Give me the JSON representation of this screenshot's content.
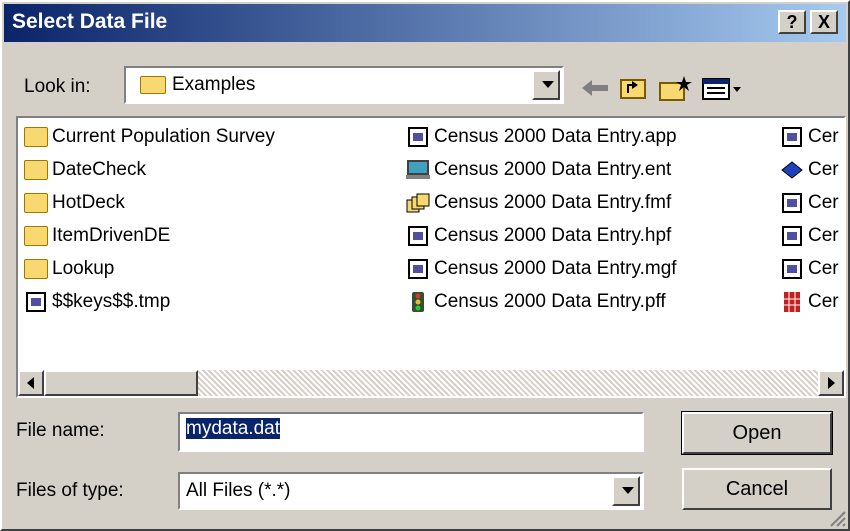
{
  "window": {
    "title": "Select Data File"
  },
  "titlebar_buttons": {
    "help": "?",
    "close": "X"
  },
  "look_in": {
    "label": "Look in:",
    "value": "Examples"
  },
  "files": {
    "col1": [
      {
        "name": "Current Population Survey",
        "icon": "folder-icon"
      },
      {
        "name": "DateCheck",
        "icon": "folder-icon"
      },
      {
        "name": "HotDeck",
        "icon": "folder-icon"
      },
      {
        "name": "ItemDrivenDE",
        "icon": "folder-icon"
      },
      {
        "name": "Lookup",
        "icon": "folder-icon"
      },
      {
        "name": "$$keys$$.tmp",
        "icon": "file-icon"
      }
    ],
    "col2": [
      {
        "name": "Census 2000 Data Entry.app",
        "icon": "file-icon"
      },
      {
        "name": "Census 2000 Data Entry.ent",
        "icon": "monitor-icon"
      },
      {
        "name": "Census 2000 Data Entry.fmf",
        "icon": "forms-icon"
      },
      {
        "name": "Census 2000 Data Entry.hpf",
        "icon": "file-icon"
      },
      {
        "name": "Census 2000 Data Entry.mgf",
        "icon": "file-icon"
      },
      {
        "name": "Census 2000 Data Entry.pff",
        "icon": "traffic-light-icon"
      }
    ],
    "col3": [
      {
        "name": "Cer",
        "icon": "file-icon"
      },
      {
        "name": "Cer",
        "icon": "book-icon"
      },
      {
        "name": "Cer",
        "icon": "file-icon"
      },
      {
        "name": "Cer",
        "icon": "file-icon"
      },
      {
        "name": "Cer",
        "icon": "file-icon"
      },
      {
        "name": "Cer",
        "icon": "grid-icon"
      }
    ]
  },
  "file_name": {
    "label": "File name:",
    "value": "mydata.dat"
  },
  "file_type": {
    "label": "Files of type:",
    "value": "All Files  (*.*)"
  },
  "buttons": {
    "open": "Open",
    "cancel": "Cancel"
  },
  "colors": {
    "title_start": "#0a246a",
    "title_end": "#a6caf0",
    "face": "#d4d0c8",
    "folder": "#f8d870",
    "selection": "#0a246a"
  }
}
